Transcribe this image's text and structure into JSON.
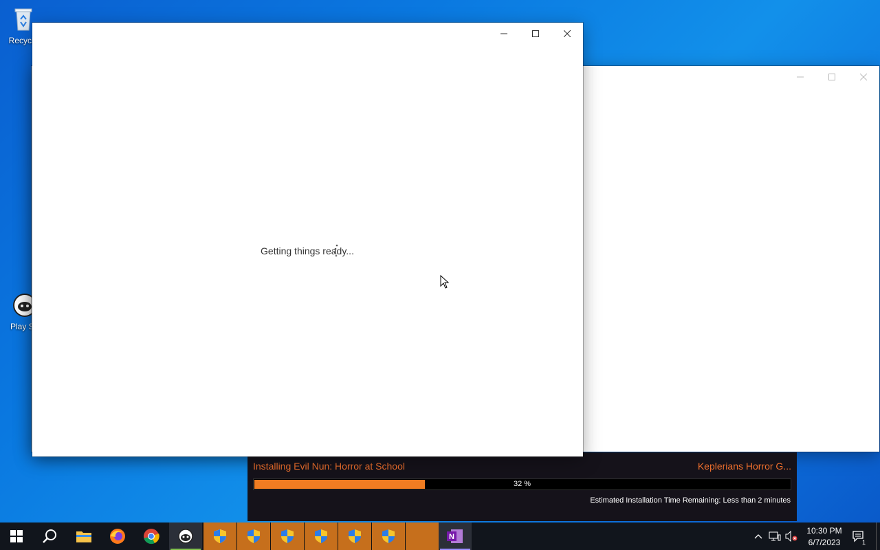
{
  "desktop": {
    "icons": [
      {
        "label": "Recycle",
        "icon": "recycle-bin-icon"
      },
      {
        "label": "Play St",
        "icon": "play-store-icon"
      }
    ]
  },
  "front_window": {
    "status_text": "Getting things ready...",
    "controls": [
      "minimize-icon",
      "maximize-icon",
      "close-icon"
    ]
  },
  "back_window": {
    "controls": [
      "minimize-icon",
      "maximize-icon",
      "close-icon"
    ]
  },
  "installer": {
    "title": "Installing Evil Nun: Horror at School",
    "publisher": "Keplerians Horror G...",
    "progress_percent": 32,
    "progress_text": "32 %",
    "eta": "Estimated Installation Time Remaining: Less than  2 minutes",
    "colors": {
      "accent": "#f07d22",
      "title": "#ee6f2d",
      "background": "#15121a"
    }
  },
  "taskbar": {
    "buttons": [
      "start-icon",
      "search-icon",
      "file-explorer-icon",
      "firefox-icon",
      "chrome-icon",
      "bluestacks-icon",
      "uac-shield-icon",
      "uac-shield-icon",
      "uac-shield-icon",
      "uac-shield-icon",
      "uac-shield-icon",
      "uac-shield-icon",
      "blank-window",
      "onenote-icon"
    ],
    "tray": {
      "time": "10:30 PM",
      "date": "6/7/2023",
      "notification_count": "1"
    }
  }
}
